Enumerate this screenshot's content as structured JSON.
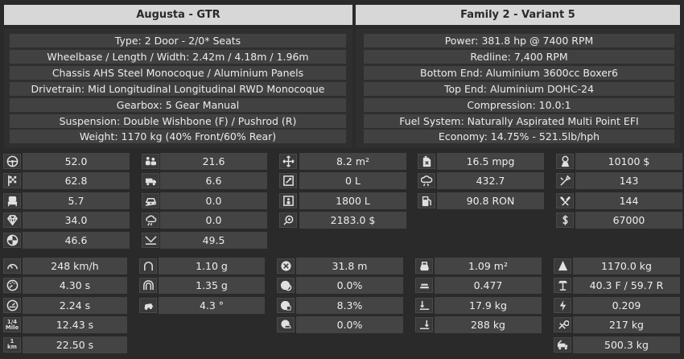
{
  "left": {
    "title": "Augusta - GTR",
    "specs": [
      "Type: 2 Door - 2/0* Seats",
      "Wheelbase / Length / Width: 2.42m / 4.18m / 1.96m",
      "Chassis AHS Steel Monocoque / Aluminium Panels",
      "Drivetrain: Mid Longitudinal Longitudinal RWD Monocoque",
      "Gearbox: 5 Gear Manual",
      "Suspension: Double Wishbone (F) / Pushrod (R)",
      "Weight: 1170 kg (40% Front/60% Rear)"
    ]
  },
  "right": {
    "title": "Family 2 - Variant 5",
    "specs": [
      "Power: 381.8 hp @ 7400 RPM",
      "Redline:  7,400 RPM",
      "Bottom End: Aluminium 3600cc Boxer6",
      "Top End: Aluminium DOHC-24",
      "Compression: 10.0:1",
      "Fuel System: Naturally Aspirated Multi Point EFI",
      "Economy: 14.75% - 521.5lb/hph"
    ]
  },
  "ratings": {
    "col1": [
      {
        "icon": "steering-wheel-icon",
        "value": "52.0"
      },
      {
        "icon": "checkered-flag-icon",
        "value": "62.8"
      },
      {
        "icon": "car-seat-icon",
        "value": "5.7"
      },
      {
        "icon": "diamond-icon",
        "value": "34.0"
      },
      {
        "icon": "safety-badge-icon",
        "value": "46.6"
      }
    ],
    "col2": [
      {
        "icon": "passengers-icon",
        "value": "21.6"
      },
      {
        "icon": "cargo-truck-icon",
        "value": "6.6"
      },
      {
        "icon": "offroad-car-icon",
        "value": "0.0"
      },
      {
        "icon": "emissions-icon",
        "value": "0.0"
      },
      {
        "icon": "ground-clearance-icon",
        "value": "49.5"
      }
    ],
    "col3": [
      {
        "icon": "dimensions-icon",
        "value": "8.2 m²"
      },
      {
        "icon": "trunk-icon",
        "value": "0 L"
      },
      {
        "icon": "fuel-tank-icon",
        "value": "1800 L"
      },
      {
        "icon": "cost-gear-icon",
        "value": "2183.0 $"
      }
    ],
    "col4": [
      {
        "icon": "fuel-can-icon",
        "value": "16.5 mpg"
      },
      {
        "icon": "pollution-cloud-icon",
        "value": "432.7"
      },
      {
        "icon": "fuel-pump-icon",
        "value": "90.8 RON"
      }
    ],
    "col5": [
      {
        "icon": "price-tag-icon",
        "value": "10100 $"
      },
      {
        "icon": "engineering-icon",
        "value": "143"
      },
      {
        "icon": "production-icon",
        "value": "144"
      },
      {
        "icon": "dollar-icon",
        "value": "67000"
      }
    ]
  },
  "performance": {
    "col1": [
      {
        "icon": "top-speed-gauge-icon",
        "value": "248 km/h"
      },
      {
        "icon": "acceleration-gauge-icon",
        "value": "4.30 s"
      },
      {
        "icon": "acceleration-100-icon",
        "value": "2.24 s"
      },
      {
        "icon": "quarter-mile-icon",
        "label": "1/4 Mile",
        "value": "12.43 s"
      },
      {
        "icon": "one-km-icon",
        "label": "1 km",
        "value": "22.50 s"
      }
    ],
    "col2": [
      {
        "icon": "cornering-icon",
        "value": "1.10 g"
      },
      {
        "icon": "cornering-max-icon",
        "value": "1.35 g"
      },
      {
        "icon": "body-roll-icon",
        "value": "4.3 °"
      }
    ],
    "col3": [
      {
        "icon": "braking-icon",
        "value": "31.8 m"
      },
      {
        "icon": "tire-wheel-icon",
        "value": "0.0%"
      },
      {
        "icon": "tire-flag-icon",
        "value": "8.3%"
      },
      {
        "icon": "tire-car-icon",
        "value": "0.0%"
      }
    ],
    "col4": [
      {
        "icon": "frontal-area-icon",
        "value": "1.09 m²"
      },
      {
        "icon": "drag-icon",
        "value": "0.477"
      },
      {
        "icon": "downforce-front-icon",
        "value": "17.9 kg"
      },
      {
        "icon": "downforce-rear-icon",
        "value": "288 kg"
      }
    ],
    "col5": [
      {
        "icon": "weight-icon",
        "value": "1170.0 kg"
      },
      {
        "icon": "weight-distribution-icon",
        "value": "40.3 F / 59.7 R"
      },
      {
        "icon": "lightning-icon",
        "value": "0.209"
      },
      {
        "icon": "wrench-tools-icon",
        "value": "217 kg"
      },
      {
        "icon": "tow-truck-icon",
        "value": "500.3 kg"
      }
    ]
  }
}
